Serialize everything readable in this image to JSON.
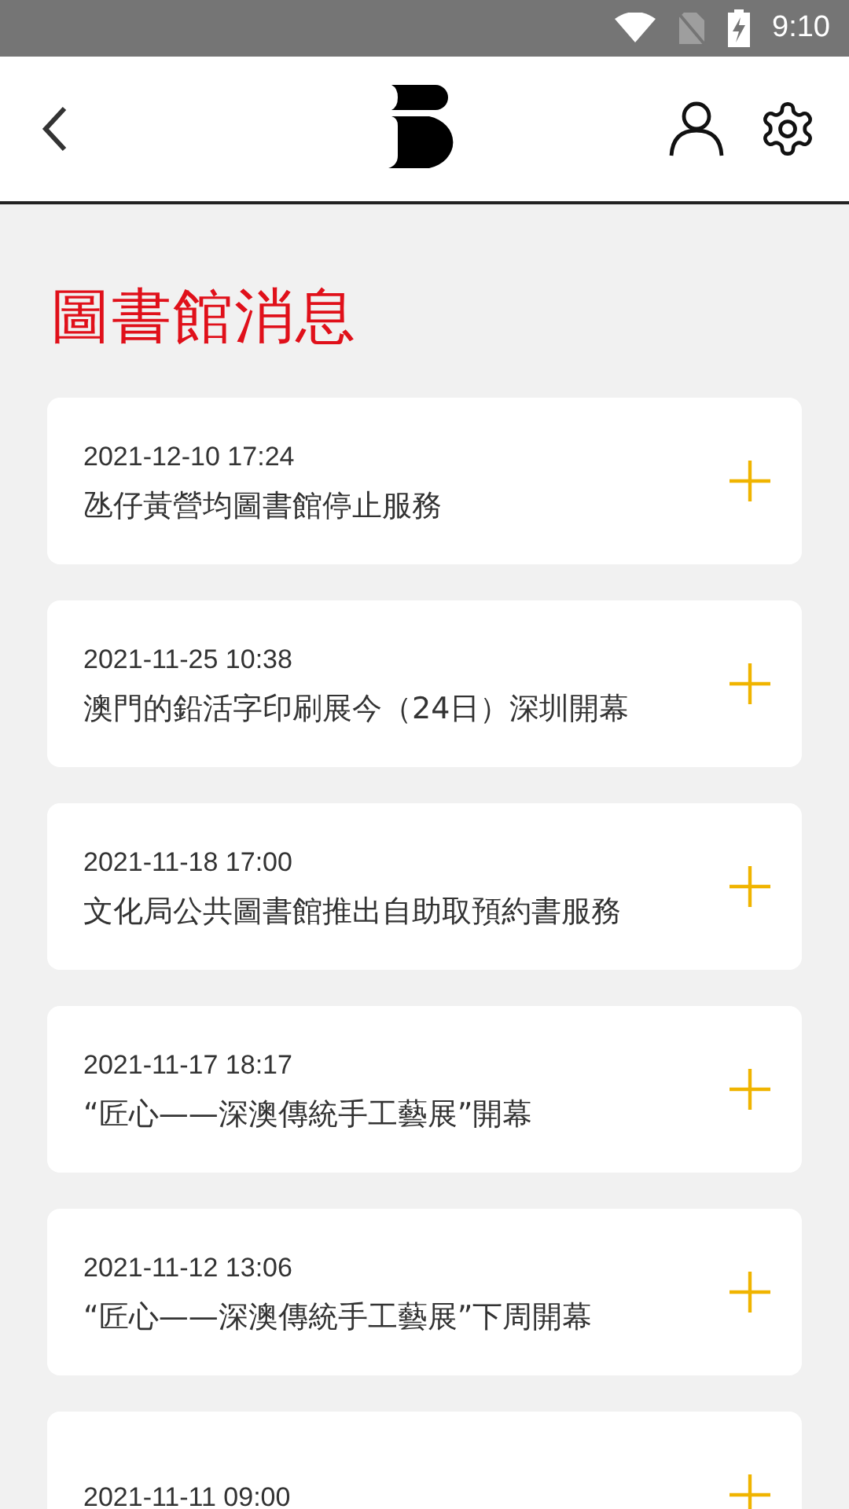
{
  "status_bar": {
    "time": "9:10"
  },
  "page": {
    "title": "圖書館消息"
  },
  "news": [
    {
      "date": "2021-12-10 17:24",
      "title": "氹仔黃營均圖書館停止服務",
      "expanded": false
    },
    {
      "date": "2021-11-25 10:38",
      "title": "澳門的鉛活字印刷展今（24日）深圳開幕",
      "expanded": false
    },
    {
      "date": "2021-11-18 17:00",
      "title": "文化局公共圖書館推出自助取預約書服務",
      "expanded": false
    },
    {
      "date": "2021-11-17 18:17",
      "title": "“匠心——深澳傳統手工藝展”開幕",
      "expanded": false
    },
    {
      "date": "2021-11-12 13:06",
      "title": "“匠心——深澳傳統手工藝展”下周開幕",
      "expanded": false
    },
    {
      "date": "2021-11-11 09:00",
      "expanded": false
    }
  ]
}
